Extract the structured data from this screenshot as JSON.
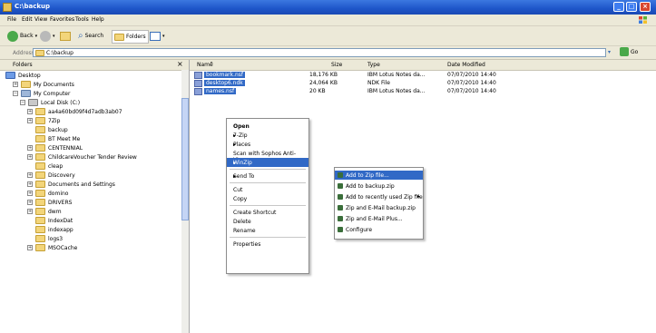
{
  "window": {
    "title": "C:\\backup"
  },
  "menu": [
    "File",
    "Edit",
    "View",
    "Favorites",
    "Tools",
    "Help"
  ],
  "toolbar": {
    "back": "Back",
    "search": "Search",
    "folders": "Folders"
  },
  "address": {
    "label": "Address",
    "path": "C:\\backup",
    "go": "Go"
  },
  "folders": {
    "header": "Folders",
    "close": "×",
    "items": [
      {
        "label": "Desktop",
        "indent": 0
      },
      {
        "label": "My Documents",
        "indent": 1
      },
      {
        "label": "My Computer",
        "indent": 1
      },
      {
        "label": "Local Disk (C:)",
        "indent": 2
      },
      {
        "label": "aa4a60bd09f4d7adb3ab07",
        "indent": 3
      },
      {
        "label": "7Zip",
        "indent": 3
      },
      {
        "label": "backup",
        "indent": 3
      },
      {
        "label": "BT Meet Me",
        "indent": 3
      },
      {
        "label": "CENTENNIAL",
        "indent": 3
      },
      {
        "label": "ChildcareVoucher Tender Review",
        "indent": 3
      },
      {
        "label": "cleap",
        "indent": 3
      },
      {
        "label": "Discovery",
        "indent": 3
      },
      {
        "label": "Documents and Settings",
        "indent": 3
      },
      {
        "label": "domino",
        "indent": 3
      },
      {
        "label": "DRIVERS",
        "indent": 3
      },
      {
        "label": "dwm",
        "indent": 3
      },
      {
        "label": "IndexDat",
        "indent": 3
      },
      {
        "label": "indexapp",
        "indent": 3
      },
      {
        "label": "logs3",
        "indent": 3
      },
      {
        "label": "MSOCache",
        "indent": 3
      }
    ]
  },
  "columns": {
    "name": "Name",
    "size": "Size",
    "type": "Type",
    "modified": "Date Modified"
  },
  "files": [
    {
      "name": "bookmark.nsf",
      "size": "18,176 KB",
      "type": "IBM Lotus Notes da...",
      "modified": "07/07/2010 14:40"
    },
    {
      "name": "desktop6.ndk",
      "size": "24,064 KB",
      "type": "NDK File",
      "modified": "07/07/2010 14:40"
    },
    {
      "name": "names.nsf",
      "size": "20 KB",
      "type": "IBM Lotus Notes da...",
      "modified": "07/07/2010 14:40"
    }
  ],
  "context_menu": [
    {
      "label": "Open",
      "bold": true
    },
    {
      "label": "7-Zip",
      "submenu": true
    },
    {
      "label": "Places",
      "submenu": true
    },
    {
      "label": "Scan with Sophos Anti-Virus"
    },
    {
      "label": "WinZip",
      "submenu": true,
      "highlight": true
    },
    {
      "sep": true
    },
    {
      "label": "Send To",
      "submenu": true
    },
    {
      "sep": true
    },
    {
      "label": "Cut"
    },
    {
      "label": "Copy"
    },
    {
      "sep": true
    },
    {
      "label": "Create Shortcut"
    },
    {
      "label": "Delete"
    },
    {
      "label": "Rename"
    },
    {
      "sep": true
    },
    {
      "label": "Properties"
    }
  ],
  "winzip_submenu": [
    {
      "label": "Add to Zip file...",
      "highlight": true
    },
    {
      "label": "Add to backup.zip"
    },
    {
      "label": "Add to recently used Zip file",
      "submenu": true
    },
    {
      "label": "Zip and E-Mail backup.zip"
    },
    {
      "label": "Zip and E-Mail Plus..."
    },
    {
      "label": "Configure"
    }
  ],
  "colors": {
    "selection": "#3169c6",
    "titlebar": "#1e55c9"
  }
}
